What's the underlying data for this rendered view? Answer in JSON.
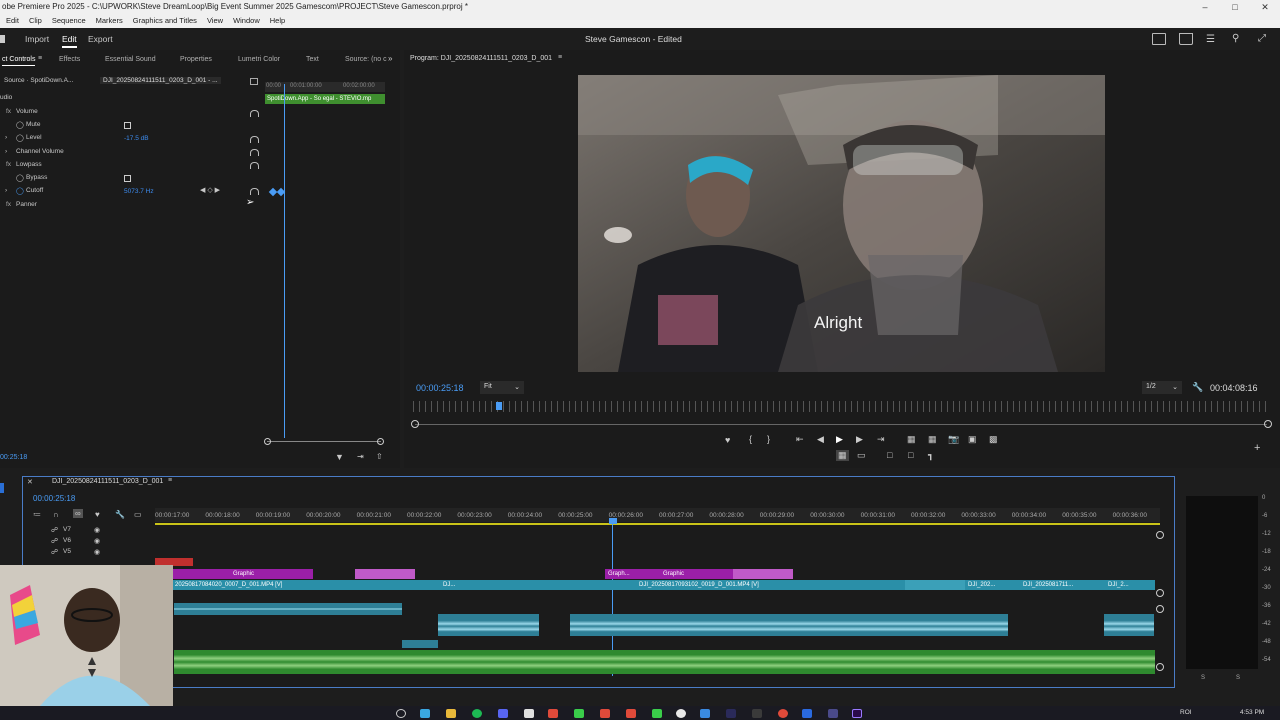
{
  "window": {
    "title": "obe Premiere Pro 2025 - C:\\UPWORK\\Steve DreamLoop\\Big Event Summer 2025 Gamescom\\PROJECT\\Steve Gamescon.prproj *"
  },
  "menu": [
    "Edit",
    "Clip",
    "Sequence",
    "Markers",
    "Graphics and Titles",
    "View",
    "Window",
    "Help"
  ],
  "workspace": {
    "tabs": [
      "Import",
      "Edit",
      "Export"
    ],
    "active": "Edit",
    "project_title": "Steve Gamescon",
    "status": " - Edited"
  },
  "left_panel": {
    "tabs": [
      "ct Controls",
      "Effects",
      "Essential Sound",
      "Properties",
      "Lumetri Color",
      "Text",
      "Source: (no c"
    ],
    "source_label": "Source · SpotiDown.A...",
    "clip_label": "DJI_20250824111511_0203_D_001 - ...",
    "section": "udio",
    "mini_ruler": [
      "00:00",
      "00:01:00:00",
      "00:02:00:00"
    ],
    "mini_clip": "SpotiDown.App - So egal - STEVIO.mp",
    "rows": {
      "volume": "Volume",
      "mute": "Mute",
      "level": "Level",
      "level_value": "-17.5 dB",
      "channel_volume": "Channel Volume",
      "lowpass": "Lowpass",
      "bypass": "Bypass",
      "cutoff": "Cutoff",
      "cutoff_value": "5073.7 Hz",
      "panner": "Panner"
    },
    "fx": "fx",
    "timecode": "00:25:18"
  },
  "program": {
    "label": "Program: DJI_20250824111511_0203_D_001",
    "caption": "Alright",
    "timecode": "00:00:25:18",
    "fit": "Fit",
    "resolution": "1/2",
    "duration": "00:04:08:16"
  },
  "timeline": {
    "sequence_name": "DJI_20250824111511_0203_D_001",
    "timecode": "00:00:25:18",
    "ruler": [
      "00:00:17:00",
      "00:00:18:00",
      "00:00:19:00",
      "00:00:20:00",
      "00:00:21:00",
      "00:00:22:00",
      "00:00:23:00",
      "00:00:24:00",
      "00:00:25:00",
      "00:00:26:00",
      "00:00:27:00",
      "00:00:28:00",
      "00:00:29:00",
      "00:00:30:00",
      "00:00:31:00",
      "00:00:32:00",
      "00:00:33:00",
      "00:00:34:00",
      "00:00:35:00",
      "00:00:36:00"
    ],
    "tracks": [
      "V7",
      "V6",
      "V5"
    ],
    "clips": {
      "graphic1": "Graphic",
      "graphic2": "Graphic",
      "graphic3": "Graph...",
      "graphic4": "Graphic",
      "v1a": "2025081708402​0_0007_D_001.MP4 [V]",
      "v1b": "DJ...",
      "v1c": "DJI_20250817093102_0019_D_001.MP4 [V]",
      "v1d": "DJI_202...",
      "v1e": "DJI_20250817​11...",
      "v1f": "DJI_2..."
    }
  },
  "meter": {
    "labels": [
      "0",
      "-6",
      "-12",
      "-18",
      "-24",
      "-30",
      "-36",
      "-42",
      "-48",
      "-54"
    ],
    "bottom": [
      "S",
      "S"
    ]
  },
  "taskbar": {
    "time": "4:53 PM",
    "lang": "ROI"
  },
  "colors": {
    "accent_blue": "#4a9cf5",
    "clip_purple": "#9b1fa8",
    "clip_teal": "#2a8fa8",
    "clip_green": "#2f8a2f",
    "playhead": "#4a9cf5"
  }
}
